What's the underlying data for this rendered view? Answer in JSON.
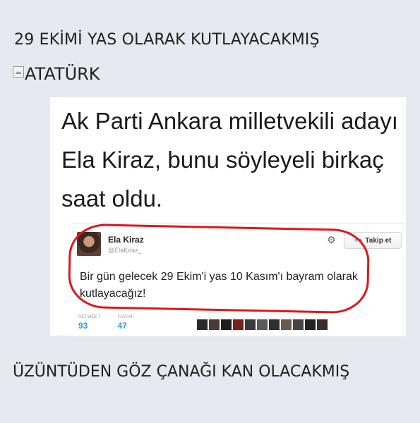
{
  "post": {
    "heading": "29 EKİMİ YAS OLARAK KUTLAYACAKMIŞ",
    "image_alt": "ATATÜRK",
    "footer": "ÜZÜNTÜDEN GÖZ ÇANAĞI KAN OLACAKMIŞ"
  },
  "screenshot": {
    "headline": "Ak Parti Ankara milletvekili adayı Ela Kiraz, bunu söyleyeli birkaç saat oldu.",
    "tweet": {
      "author_name": "Ela Kiraz",
      "author_handle": "@ElaKiraz_",
      "follow_label": "Takip et",
      "text": "Bir gün gelecek 29 Ekim'i yas 10 Kasım'ı bayram olarak kutlayacağız!",
      "retweet_label": "RETWEET",
      "retweet_count": "93",
      "favorite_label": "FAVORI",
      "favorite_count": "47",
      "favoriter_avatar_count": 11
    }
  },
  "colors": {
    "background": "#e8e8f0",
    "highlight_oval": "#e0161b",
    "link_blue": "#2b9be6"
  },
  "icons": {
    "broken_image": "broken-image-icon",
    "settings": "gear-icon",
    "follow": "add-user-icon"
  }
}
